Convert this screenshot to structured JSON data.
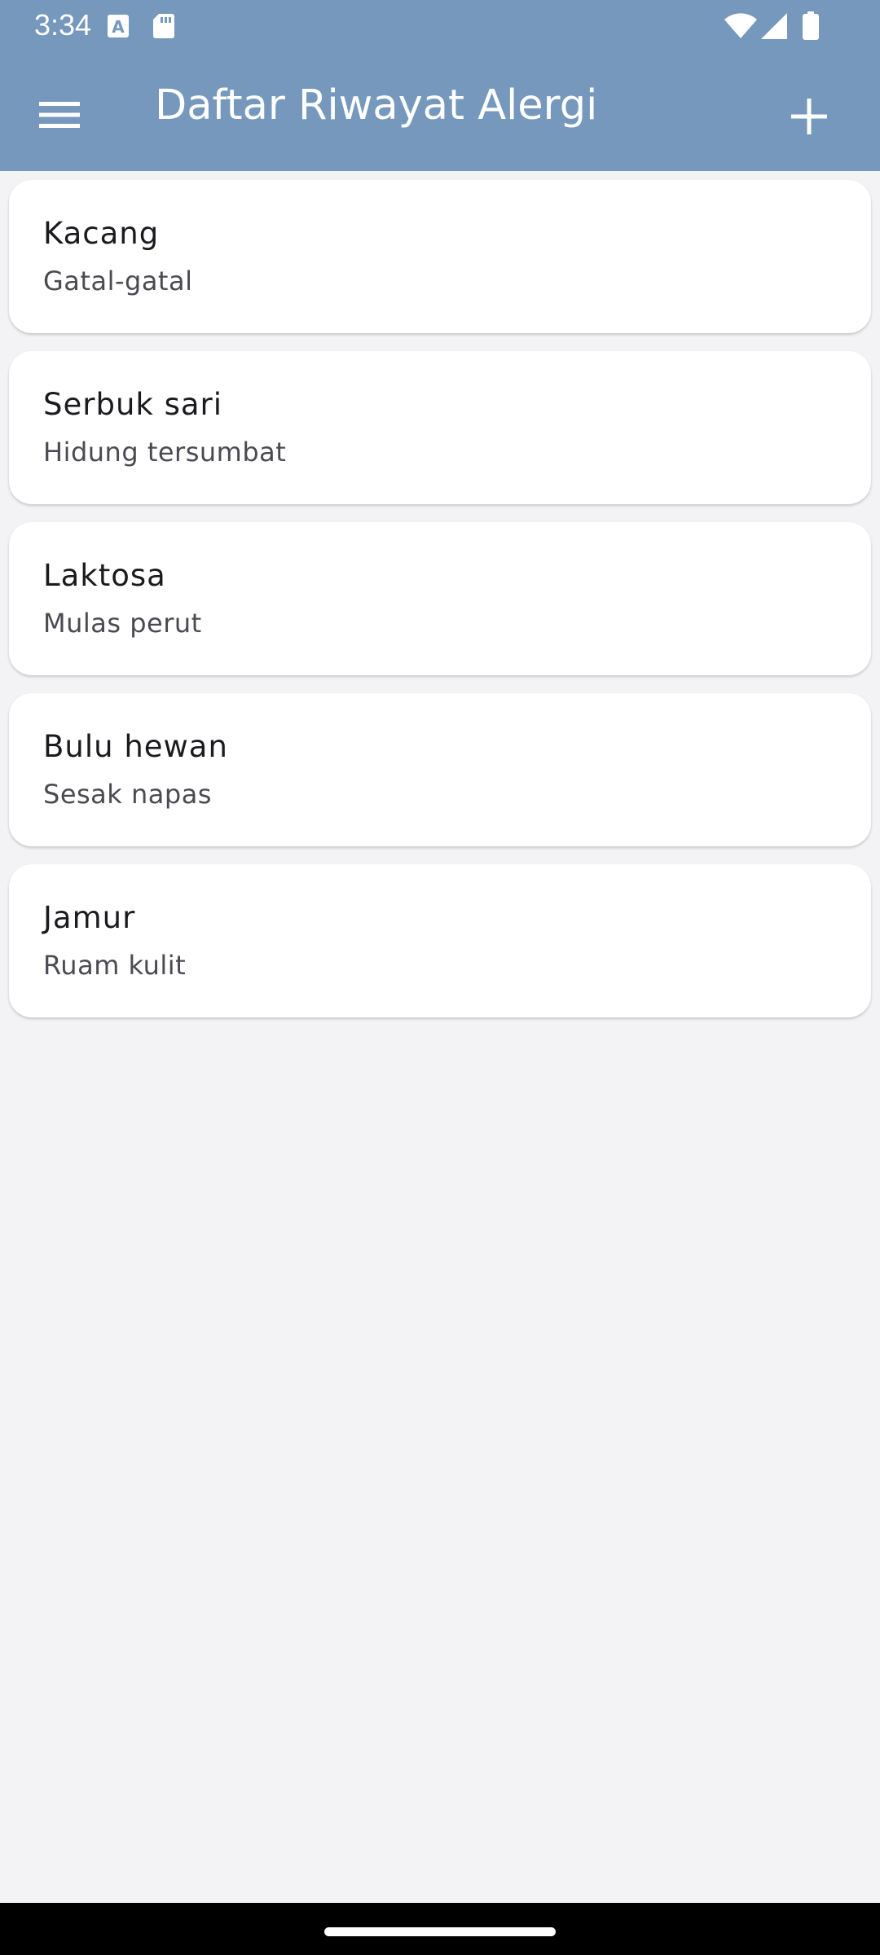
{
  "status_bar": {
    "time": "3:34",
    "icons": [
      "text-a-icon",
      "sd-card-icon",
      "wifi-icon",
      "signal-icon",
      "battery-icon"
    ]
  },
  "app_bar": {
    "title": "Daftar Riwayat Alergi",
    "menu_icon": "hamburger-menu-icon",
    "add_icon": "plus-icon"
  },
  "allergies": [
    {
      "name": "Kacang",
      "reaction": "Gatal-gatal"
    },
    {
      "name": "Serbuk sari",
      "reaction": "Hidung tersumbat"
    },
    {
      "name": "Laktosa",
      "reaction": "Mulas perut"
    },
    {
      "name": "Bulu hewan",
      "reaction": "Sesak napas"
    },
    {
      "name": "Jamur",
      "reaction": "Ruam kulit"
    }
  ],
  "colors": {
    "header": "#7698bc",
    "background": "#f3f3f5",
    "card": "#ffffff"
  }
}
